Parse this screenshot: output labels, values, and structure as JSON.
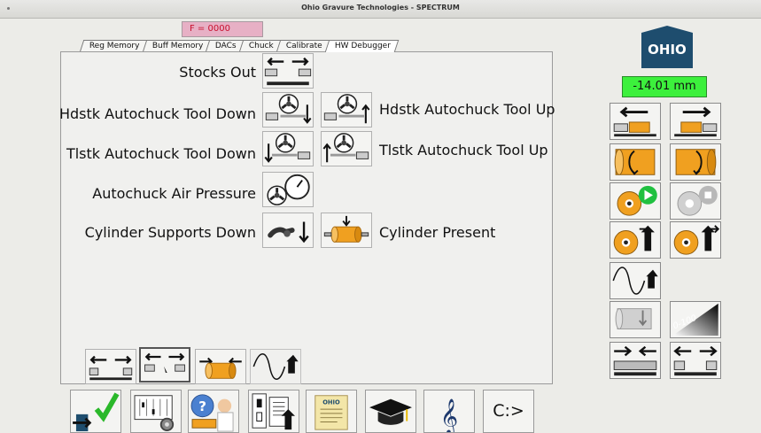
{
  "window": {
    "title": "Ohio Gravure Technologies - SPECTRUM"
  },
  "feed": {
    "value": "F = 0000"
  },
  "tabs": [
    {
      "label": "Reg Memory"
    },
    {
      "label": "Buff Memory"
    },
    {
      "label": "DACs"
    },
    {
      "label": "Chuck"
    },
    {
      "label": "Calibrate"
    },
    {
      "label": "HW Debugger",
      "active": true
    }
  ],
  "debugger": {
    "stocks_out": "Stocks Out",
    "hdstk_down": "Hdstk Autochuck Tool Down",
    "hdstk_up": "Hdstk Autochuck Tool Up",
    "tlstk_down": "Tlstk Autochuck Tool Down",
    "tlstk_up": "Tlstk Autochuck Tool Up",
    "air_pressure": "Autochuck Air Pressure",
    "supports_down": "Cylinder Supports Down",
    "cyl_present": "Cylinder Present"
  },
  "logo": {
    "text": "OHIO"
  },
  "position": {
    "value": "-14.01 mm"
  },
  "scale_icon_text": "0-100",
  "bottom": {
    "command_label": "C:>",
    "scroll_text": "OHIO"
  },
  "colors": {
    "accent_green": "#3cf03c",
    "orange": "#f0a020",
    "logo": "#1e4d6e",
    "feed_bg": "#e7b0c5",
    "feed_text": "#c8102e"
  },
  "icons": [
    "stocks-out-icon",
    "chuck-tool-down-icon",
    "chuck-tool-up-icon",
    "pressure-gauge-icon",
    "cylinder-support-icon",
    "cylinder-present-icon",
    "headstock-icon",
    "tailstock-icon",
    "rotate-icon",
    "play-icon",
    "stop-icon",
    "sine-wave-icon",
    "checkmark-icon",
    "help-icon",
    "graduation-cap-icon",
    "treble-clef-icon"
  ]
}
